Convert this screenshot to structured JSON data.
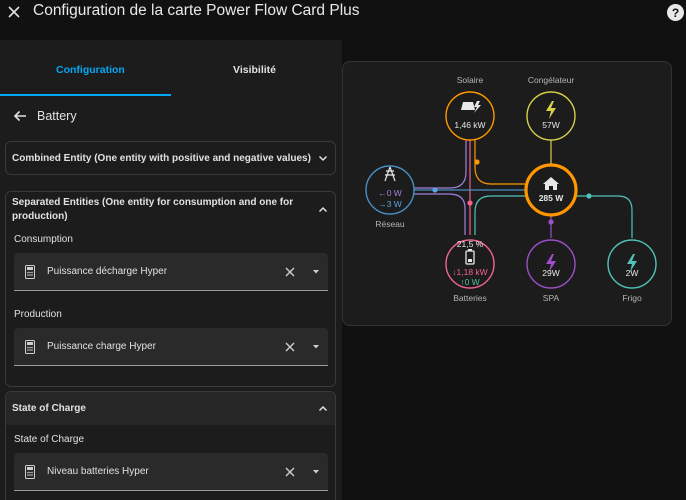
{
  "header": {
    "title": "Configuration de la carte Power Flow Card Plus",
    "help_glyph": "?"
  },
  "tabs": [
    {
      "label": "Configuration",
      "active": true
    },
    {
      "label": "Visibilité",
      "active": false
    }
  ],
  "back": {
    "label": "Battery"
  },
  "sections": {
    "combined": {
      "title": "Combined Entity (One entity with positive and negative values)",
      "expanded": false
    },
    "separated": {
      "title": "Separated Entities (One entity for consumption and one for production)",
      "expanded": true,
      "consumption_label": "Consumption",
      "consumption_value": "Puissance décharge Hyper",
      "production_label": "Production",
      "production_value": "Puissance charge Hyper"
    },
    "soc": {
      "title": "State of Charge",
      "expanded": true,
      "field_label": "State of Charge",
      "field_value": "Niveau batteries Hyper"
    }
  },
  "flow": {
    "solar": {
      "label": "Solaire",
      "value": "1,46 kW",
      "color": "#ff9800"
    },
    "freezer": {
      "label": "Congélateur",
      "value": "57W",
      "color": "#d4d04a"
    },
    "grid": {
      "label": "Réseau",
      "import": "←0 W",
      "export": "→3 W",
      "color": "#488fc2",
      "import_color": "#a280db",
      "export_color": "#5ea1e0"
    },
    "home": {
      "value": "285 W",
      "color": "#ff9800"
    },
    "battery": {
      "label": "Batteries",
      "soc": "21,5 %",
      "discharge": "↓1,18 kW",
      "charge": "↑0 W",
      "color": "#f06292",
      "charge_color": "#50c0a0"
    },
    "spa": {
      "label": "SPA",
      "value": "29W",
      "color": "#9c4fc8"
    },
    "fridge": {
      "label": "Frigo",
      "value": "2W",
      "color": "#4fc3b7"
    }
  },
  "colors": {
    "accent": "#03a9f4",
    "background": "#111111",
    "panel": "#1c1c1c"
  }
}
